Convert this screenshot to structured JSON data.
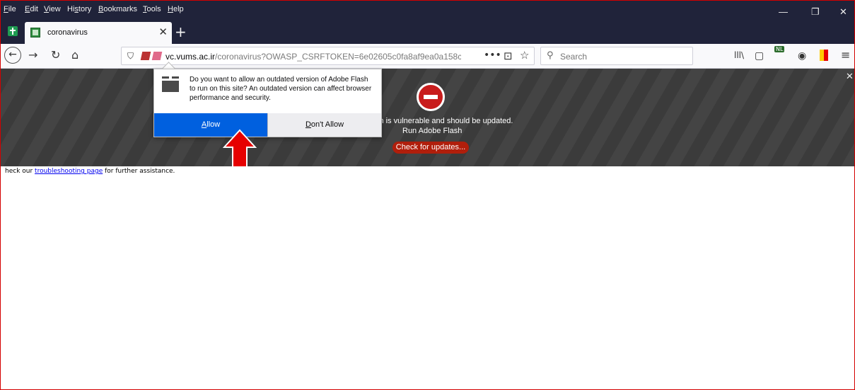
{
  "menu": [
    {
      "key": "F",
      "rest": "ile"
    },
    {
      "key": "E",
      "rest": "dit"
    },
    {
      "key": "V",
      "rest": "iew"
    },
    {
      "pre": "Hi",
      "key": "s",
      "rest": "tory"
    },
    {
      "key": "B",
      "rest": "ookmarks"
    },
    {
      "key": "T",
      "rest": "ools"
    },
    {
      "key": "H",
      "rest": "elp"
    }
  ],
  "window_controls": {
    "minimize": "—",
    "restore": "❐",
    "close": "✕"
  },
  "tab": {
    "title": "coronavirus",
    "close": "✕"
  },
  "new_tab": "+",
  "nav": {
    "back": "←",
    "forward": "→",
    "reload": "↻",
    "home": "⌂"
  },
  "url": {
    "host": "vc.vums.ac.ir",
    "path": "/coronavirus?OWASP_CSRFTOKEN=6e02605c0fa8af9ea0a158c",
    "page_actions": "•••",
    "pocket": "⊡",
    "star": "☆"
  },
  "search": {
    "placeholder": "Search",
    "icon": "search-icon"
  },
  "toolbar_icons": {
    "library": "lll\\",
    "sidebar": "▢",
    "extension_badge": "NL",
    "account": "◉",
    "menu": "≡"
  },
  "flash_banner": {
    "message_line1": "in is vulnerable and should be updated.",
    "message_line2": "Run Adobe Flash",
    "button": "Check for updates...",
    "close": "✕"
  },
  "popup": {
    "message": "Do you want to allow an outdated version of Adobe Flash to run on this site? An outdated version can affect browser performance and security.",
    "allow_key": "A",
    "allow_rest": "llow",
    "deny_key": "D",
    "deny_rest": "on't Allow"
  },
  "page": {
    "help_prefix": "heck our ",
    "help_link": "troubleshooting page",
    "help_suffix": " for further assistance."
  },
  "colors": {
    "accent": "#0060df",
    "chrome_dark": "#20233a",
    "alert_red": "#b01e0b",
    "annotation_red": "#e60000"
  }
}
